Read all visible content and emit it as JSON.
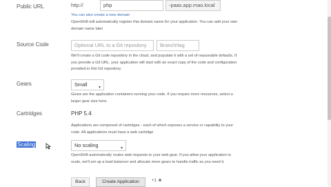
{
  "public_url": {
    "label": "Public URL",
    "prefix": "http://",
    "app_name": "php",
    "suffix": "-paas.app.mao.local",
    "link_text": "You can also create a new domain",
    "help": "OpenShift will automatically register this domain name for your application. You can add your own domain name later"
  },
  "source_code": {
    "label": "Source Code",
    "repo_placeholder": "Optional URL to a Git repository",
    "branch_placeholder": "Branch/tag",
    "help": "We'll create a Git code repository in the cloud, and populate it with a set of reasonable defaults. If you provide a Git URL, your application will start with an exact copy of the code and configuration provided in this Git repository"
  },
  "gears": {
    "label": "Gears",
    "selected": "Small",
    "help": "Gears are the application containers running your code. If you require more resources, select a larger gear size here."
  },
  "cartridges": {
    "label": "Cartridges",
    "value": "PHP 5.4",
    "help": "Applications are composed of cartridges - each of which exposes a service or capability to your code. All applications must have a web cartridge"
  },
  "scaling": {
    "label": "Scaling",
    "selected": "No scaling",
    "help": "OpenShift automatically routes web requests to your web gear. If you allow your application to scale, we'll set up a load balancer and allocate more gears to handle traffic as you need it."
  },
  "actions": {
    "back": "Back",
    "create": "Create Application",
    "plus": "+1"
  }
}
